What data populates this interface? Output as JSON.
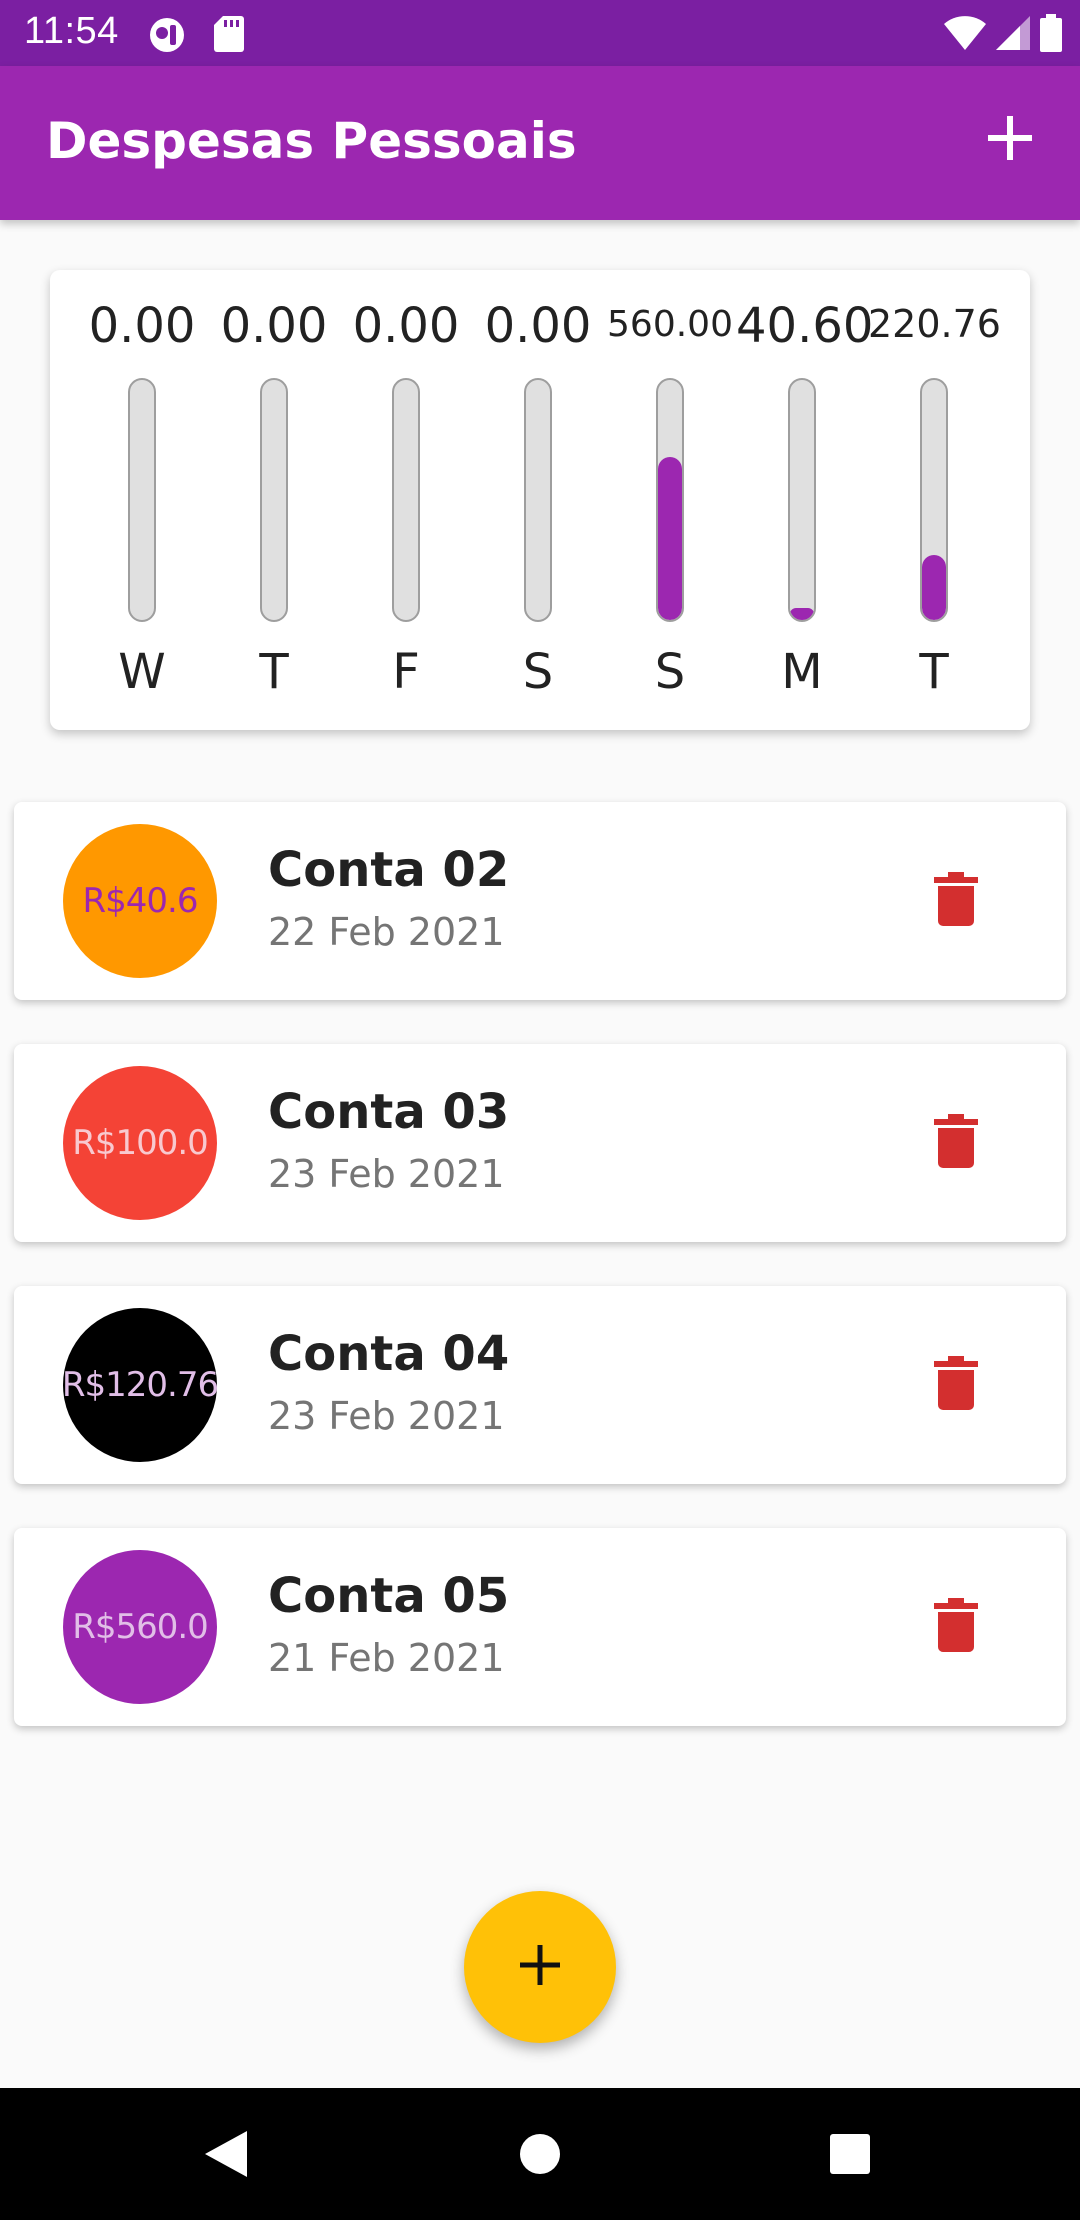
{
  "status_bar": {
    "time": "11:54",
    "left_icons": [
      "vpn-key-icon",
      "sd-card-icon"
    ],
    "right_icons": [
      "wifi-icon",
      "cell-signal-icon",
      "battery-icon"
    ]
  },
  "app_bar": {
    "title": "Despesas Pessoais",
    "add_icon": "plus-icon"
  },
  "chart": {
    "bar_color": "#9c27b0",
    "days": [
      {
        "day": "W",
        "value": "0.00",
        "fill_fraction": 0.0
      },
      {
        "day": "T",
        "value": "0.00",
        "fill_fraction": 0.0
      },
      {
        "day": "F",
        "value": "0.00",
        "fill_fraction": 0.0
      },
      {
        "day": "S",
        "value": "0.00",
        "fill_fraction": 0.0
      },
      {
        "day": "S",
        "value": "560.00",
        "fill_fraction": 0.68
      },
      {
        "day": "M",
        "value": "40.60",
        "fill_fraction": 0.05
      },
      {
        "day": "T",
        "value": "220.76",
        "fill_fraction": 0.27
      }
    ]
  },
  "transactions": [
    {
      "title": "Conta 02",
      "date": "22 Feb 2021",
      "amount": "R$40.6",
      "avatar_color": "#ff9800",
      "amount_color": "#9c27b0"
    },
    {
      "title": "Conta 03",
      "date": "23 Feb 2021",
      "amount": "R$100.0",
      "avatar_color": "#f44336",
      "amount_color": "#f8c9cf"
    },
    {
      "title": "Conta 04",
      "date": "23 Feb 2021",
      "amount": "R$120.76",
      "avatar_color": "#000000",
      "amount_color": "#e1bee7"
    },
    {
      "title": "Conta 05",
      "date": "21 Feb 2021",
      "amount": "R$560.0",
      "avatar_color": "#9c27b0",
      "amount_color": "#e1bee7"
    }
  ],
  "delete_icon": "trash-icon",
  "delete_color": "#d32f2f",
  "fab": {
    "icon": "plus-icon",
    "color": "#ffc107"
  },
  "nav_bar": {
    "icons": [
      "back-icon",
      "home-icon",
      "recents-icon"
    ]
  }
}
